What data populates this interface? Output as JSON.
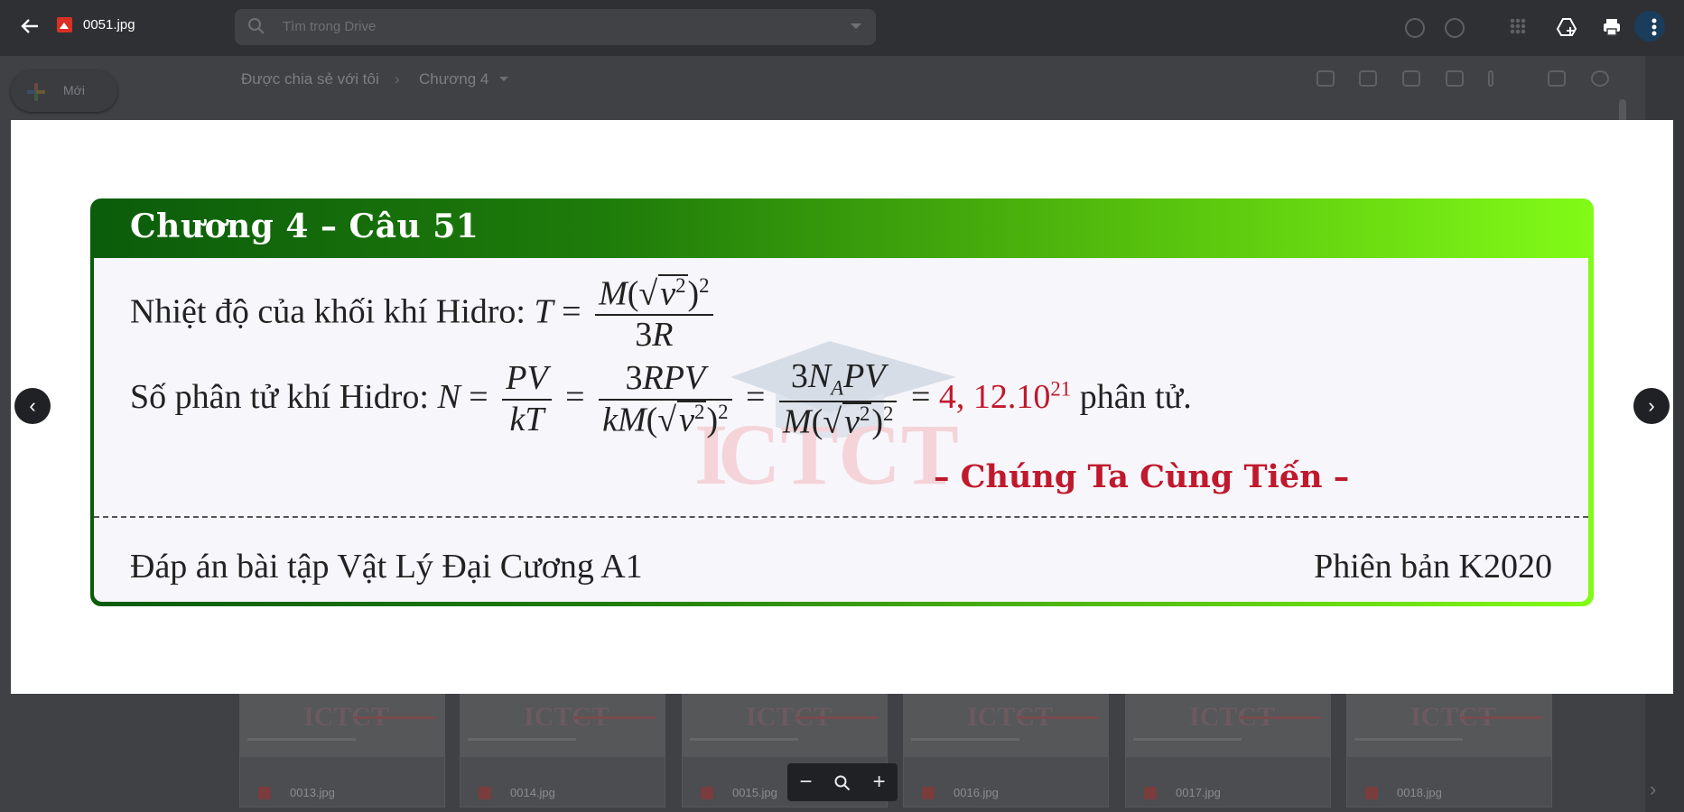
{
  "viewer": {
    "file_name": "0051.jpg",
    "zoom_out": "−",
    "zoom_in": "+",
    "prev": "‹",
    "next": "›"
  },
  "background": {
    "search_placeholder": "Tìm trong Drive",
    "new_button": "Mới",
    "breadcrumb": [
      "Được chia sẻ với tôi",
      "Chương 4"
    ],
    "files": [
      "0013.jpg",
      "0014.jpg",
      "0015.jpg",
      "0016.jpg",
      "0017.jpg",
      "0018.jpg"
    ]
  },
  "slide": {
    "header": "Chương 4 – Câu 51",
    "line1_text": "Nhiệt độ của khối khí Hidro:",
    "line2_text": "Số phân tử khí Hidro:",
    "result": "4, 12.10",
    "result_exp": "21",
    "unit": "phân tử.",
    "slogan": "– Chúng Ta Cùng Tiến –",
    "footer_left": "Đáp án bài tập Vật Lý Đại Cương A1",
    "footer_right": "Phiên bản K2020"
  },
  "colors": {
    "accent_red": "#c0182c",
    "header_green_start": "#0b5c0b",
    "header_green_end": "#82fb17"
  }
}
